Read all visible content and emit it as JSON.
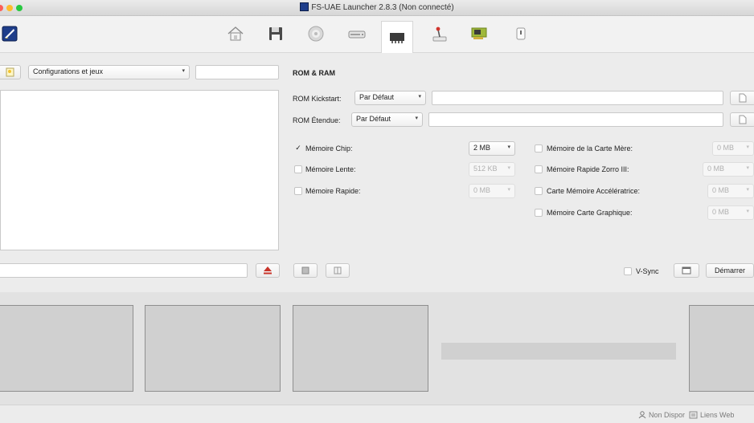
{
  "window": {
    "title": "FS-UAE Launcher 2.8.3 (Non connecté)",
    "traffic_lights": [
      "#fc5f57",
      "#fdbc2e",
      "#28c840"
    ]
  },
  "toolbar": {
    "tabs": [
      "home-icon",
      "floppy-icon",
      "cd-icon",
      "hard-drive-icon",
      "memory-icon",
      "joystick-icon",
      "expansion-card-icon",
      "input-icon"
    ],
    "active_tab": "memory-icon"
  },
  "left": {
    "category_select": "Configurations et jeux",
    "search_value": "",
    "bottom_input_value": ""
  },
  "rom": {
    "heading": "ROM & RAM",
    "kickstart_label": "ROM Kickstart:",
    "kickstart_value": "Par Défaut",
    "extended_label": "ROM Étendue:",
    "extended_value": "Par Défaut"
  },
  "memory": {
    "left": [
      {
        "label": "Mémoire Chip:",
        "checked": "✓",
        "value": "2 MB"
      },
      {
        "label": "Mémoire Lente:",
        "checked": "",
        "value": "512 KB"
      },
      {
        "label": "Mémoire Rapide:",
        "checked": "",
        "value": "0 MB"
      }
    ],
    "right": [
      {
        "label": "Mémoire de la Carte Mère:",
        "checked": "",
        "value": "0 MB"
      },
      {
        "label": "Mémoire Rapide Zorro III:",
        "checked": "",
        "value": "0 MB"
      },
      {
        "label": "Carte Mémoire Accélératrice:",
        "checked": "",
        "value": "0 MB"
      },
      {
        "label": "Mémoire Carte Graphique:",
        "checked": "",
        "value": "0 MB"
      }
    ]
  },
  "controls": {
    "vsync_label": "V-Sync",
    "start_label": "Démarrer"
  },
  "status": {
    "not_available": "Non Dispor",
    "web_links": "Liens Web"
  }
}
